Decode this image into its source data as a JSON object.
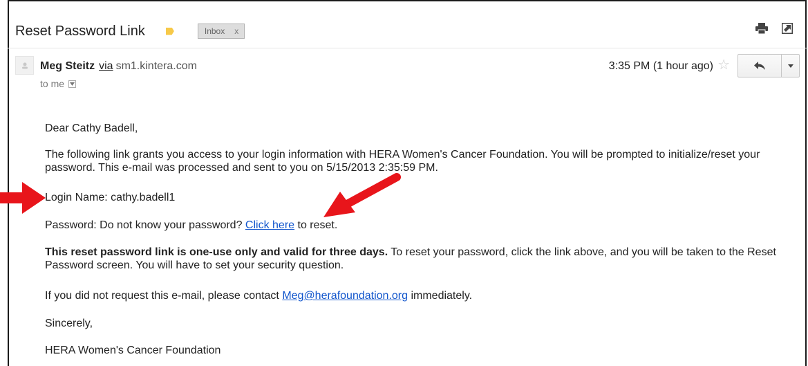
{
  "email": {
    "subject": "Reset Password Link",
    "label_chip": "Inbox",
    "label_chip_close": "x",
    "sender_name": "Meg Steitz",
    "via_text": "via",
    "sender_domain": "sm1.kintera.com",
    "to_text": "to me",
    "time": "3:35 PM (1 hour ago)",
    "icons": {
      "print": "print-icon",
      "new_window": "new-window-icon",
      "star": "star-icon",
      "reply": "reply-icon",
      "more": "more-options-icon",
      "avatar": "avatar-icon",
      "label": "label-tag-icon"
    },
    "colors": {
      "link": "#1155cc",
      "annotation_arrow": "#e8151b",
      "label_tag": "#f7c948"
    }
  },
  "body": {
    "greeting": "Dear Cathy Badell,",
    "paragraph1": "The following link grants you access to your login information with HERA Women's Cancer Foundation. You will be prompted to initialize/reset your password. This e-mail was processed and sent to you on 5/15/2013 2:35:59 PM.",
    "login_line": "Login Name: cathy.badell1",
    "password_prefix": "Password: Do not know your password?",
    "password_link": "Click here",
    "password_suffix": "to reset.",
    "notice_bold": "This reset password link is one-use only and valid for three days.",
    "notice_rest": "To reset your password, click the link above, and you will be taken to the Reset Password screen. You will have to set your security question.",
    "contact_prefix": "If you did not request this e-mail, please contact",
    "contact_email": "Meg@herafoundation.org",
    "contact_suffix": "immediately.",
    "closing": "Sincerely,",
    "signature": "HERA Women's Cancer Foundation"
  }
}
